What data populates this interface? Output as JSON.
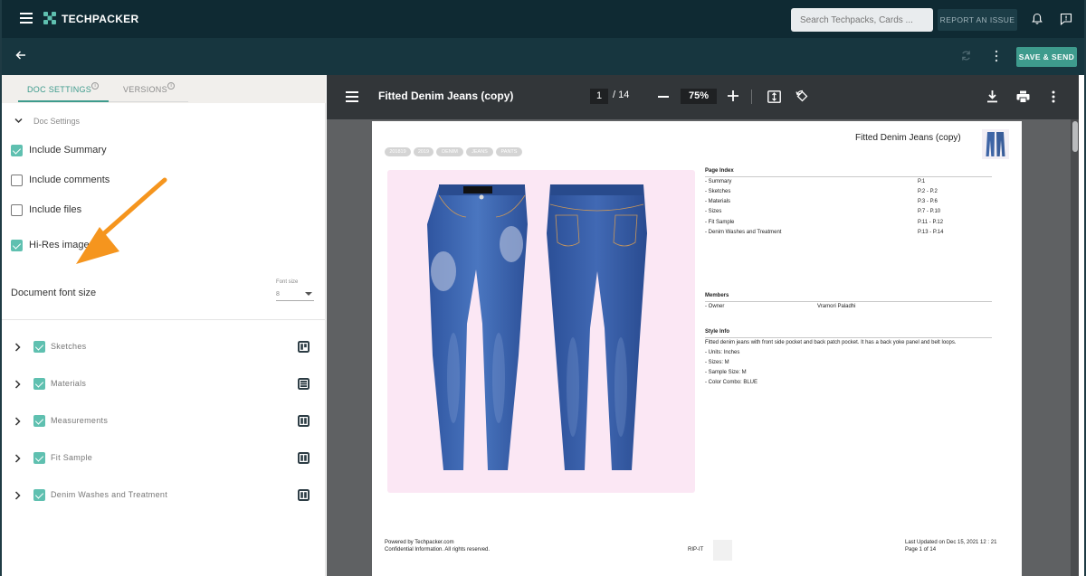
{
  "app": {
    "name": "TECHPACKER",
    "search_placeholder": "Search Techpacks, Cards ...",
    "report_label": "REPORT AN ISSUE",
    "save_send_label": "SAVE & SEND"
  },
  "left_panel": {
    "tabs": [
      {
        "label": "DOC SETTINGS"
      },
      {
        "label": "VERSIONS"
      }
    ],
    "section_title": "Doc Settings",
    "options": [
      {
        "label": "Include Summary",
        "checked": true
      },
      {
        "label": "Include comments",
        "checked": false
      },
      {
        "label": "Include files",
        "checked": false
      },
      {
        "label": "Hi-Res images",
        "checked": true
      }
    ],
    "font_size_label": "Document font size",
    "font_select": {
      "caption": "Font size",
      "value": "8"
    },
    "sections": [
      {
        "label": "Sketches",
        "checked": true
      },
      {
        "label": "Materials",
        "checked": true
      },
      {
        "label": "Measurements",
        "checked": true
      },
      {
        "label": "Fit Sample",
        "checked": true
      },
      {
        "label": "Denim Washes and Treatment",
        "checked": true
      }
    ]
  },
  "viewer": {
    "title": "Fitted Denim Jeans (copy)",
    "page_current": "1",
    "page_total": "/ 14",
    "zoom": "75%"
  },
  "document": {
    "title": "Fitted Denim Jeans (copy)",
    "tags": [
      "201819",
      "2019",
      "DENIM",
      "JEANS",
      "PANTS"
    ],
    "page_index_title": "Page Index",
    "page_index": [
      {
        "name": "- Summary",
        "pages": "P.1"
      },
      {
        "name": "- Sketches",
        "pages": "P.2 - P.2"
      },
      {
        "name": "- Materials",
        "pages": "P.3 - P.6"
      },
      {
        "name": "- Sizes",
        "pages": "P.7 - P.10"
      },
      {
        "name": "- Fit Sample",
        "pages": "P.11 - P.12"
      },
      {
        "name": "- Denim Washes and Treatment",
        "pages": "P.13 - P.14"
      }
    ],
    "members_title": "Members",
    "members": [
      {
        "role": "- Owner",
        "name": "Vramori Paladhi"
      }
    ],
    "style_info_title": "Style Info",
    "style_info_lines": [
      "Fitted denim jeans with front side pocket and back patch pocket. It has a back yoke panel and belt loops.",
      "- Units: Inches",
      "- Sizes: M",
      "- Sample Size: M",
      "- Color Combo: BLUE"
    ],
    "footer_powered": "Powered by Techpacker.com",
    "footer_confidential": "Confidential Information. All rights reserved.",
    "footer_rip": "RIP-IT",
    "footer_updated": "Last Updated on Dec 15, 2021 12 : 21",
    "footer_page": "Page 1 of 14"
  },
  "colors": {
    "topbar": "#0f2a33",
    "subbar": "#17363f",
    "accent": "#3e9b8d",
    "checkbox_on": "#5fc0b0",
    "viewer_bar": "#323639",
    "viewer_bg": "#5f6163",
    "arrow": "#f5951e"
  },
  "icons": [
    "menu-icon",
    "techpacker-logo-icon",
    "bell-icon",
    "feedback-icon",
    "back-arrow-icon",
    "sync-icon",
    "more-vertical-icon",
    "info-icon",
    "chevron-down-icon",
    "chevron-right-icon",
    "warning-icon",
    "layout-icon",
    "zoom-out-icon",
    "zoom-in-icon",
    "fit-page-icon",
    "rotate-icon",
    "download-icon",
    "print-icon"
  ]
}
